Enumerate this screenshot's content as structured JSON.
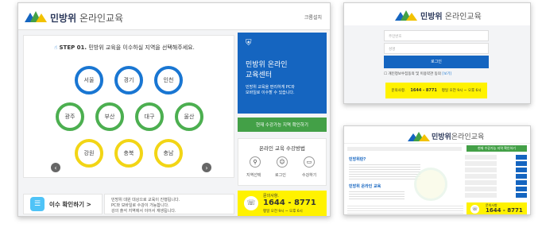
{
  "main": {
    "brand": {
      "bold": "민방위",
      "light": " 온라인교육"
    },
    "topbar_right": "크롬설치",
    "step_title": "STEP 01.",
    "step_text": "민방위 교육을 이수하실 지역을 선택해주세요.",
    "regions_row1": [
      "서울",
      "경기",
      "인천"
    ],
    "regions_row2": [
      "광주",
      "부산",
      "대구",
      "울산"
    ],
    "regions_row3": [
      "강원",
      "충북",
      "충남"
    ],
    "side": {
      "title1": "민방위 온라인",
      "title2": "교육센터",
      "desc1": "민방위 교육을 편리하게 PC와",
      "desc2": "모바일로 이수할 수 있습니다.",
      "check_btn": "현재 수강가능 지역 확인하기",
      "method_title": "온라인 교육 수강방법",
      "steps": [
        "지역선택",
        "로그인",
        "수강하기"
      ],
      "contact_label": "문의사항.",
      "phone": "1644 - 8771",
      "hours": "평일 오전 9시 ~ 오후 6시"
    },
    "complete_btn": "이수 확인하기 >",
    "notes": [
      "민방위 대원 대상으로 교육이 진행됩니다.",
      "PC와 모바일로 수강이 가능합니다.",
      "강의 출석 지역에서 이어서 재생됩니다."
    ]
  },
  "login": {
    "brand": {
      "bold": "민방위",
      "light": " 온라인교육"
    },
    "field1_placeholder": "주민번호",
    "field2_placeholder": "성명",
    "login_btn": "로그인",
    "consent_text": "개인정보수집동의 및 이용약관 동의",
    "view_link": "[보기]",
    "contact_label": "문의사항.",
    "phone": "1644 - 8771",
    "hours": "평일 오전 9시 ~ 오후 6시"
  },
  "info": {
    "brand": {
      "bold": "민방위",
      "light": "온라인교육"
    },
    "green_bar": "현재 수강가능 지역 확인하기",
    "section1": "민방위란?",
    "section2": "민방위 온라인 교육",
    "contact_label": "문의사항",
    "phone": "1644 - 8771",
    "hours": "평일 오전 9시 ~ 오후 6시"
  }
}
